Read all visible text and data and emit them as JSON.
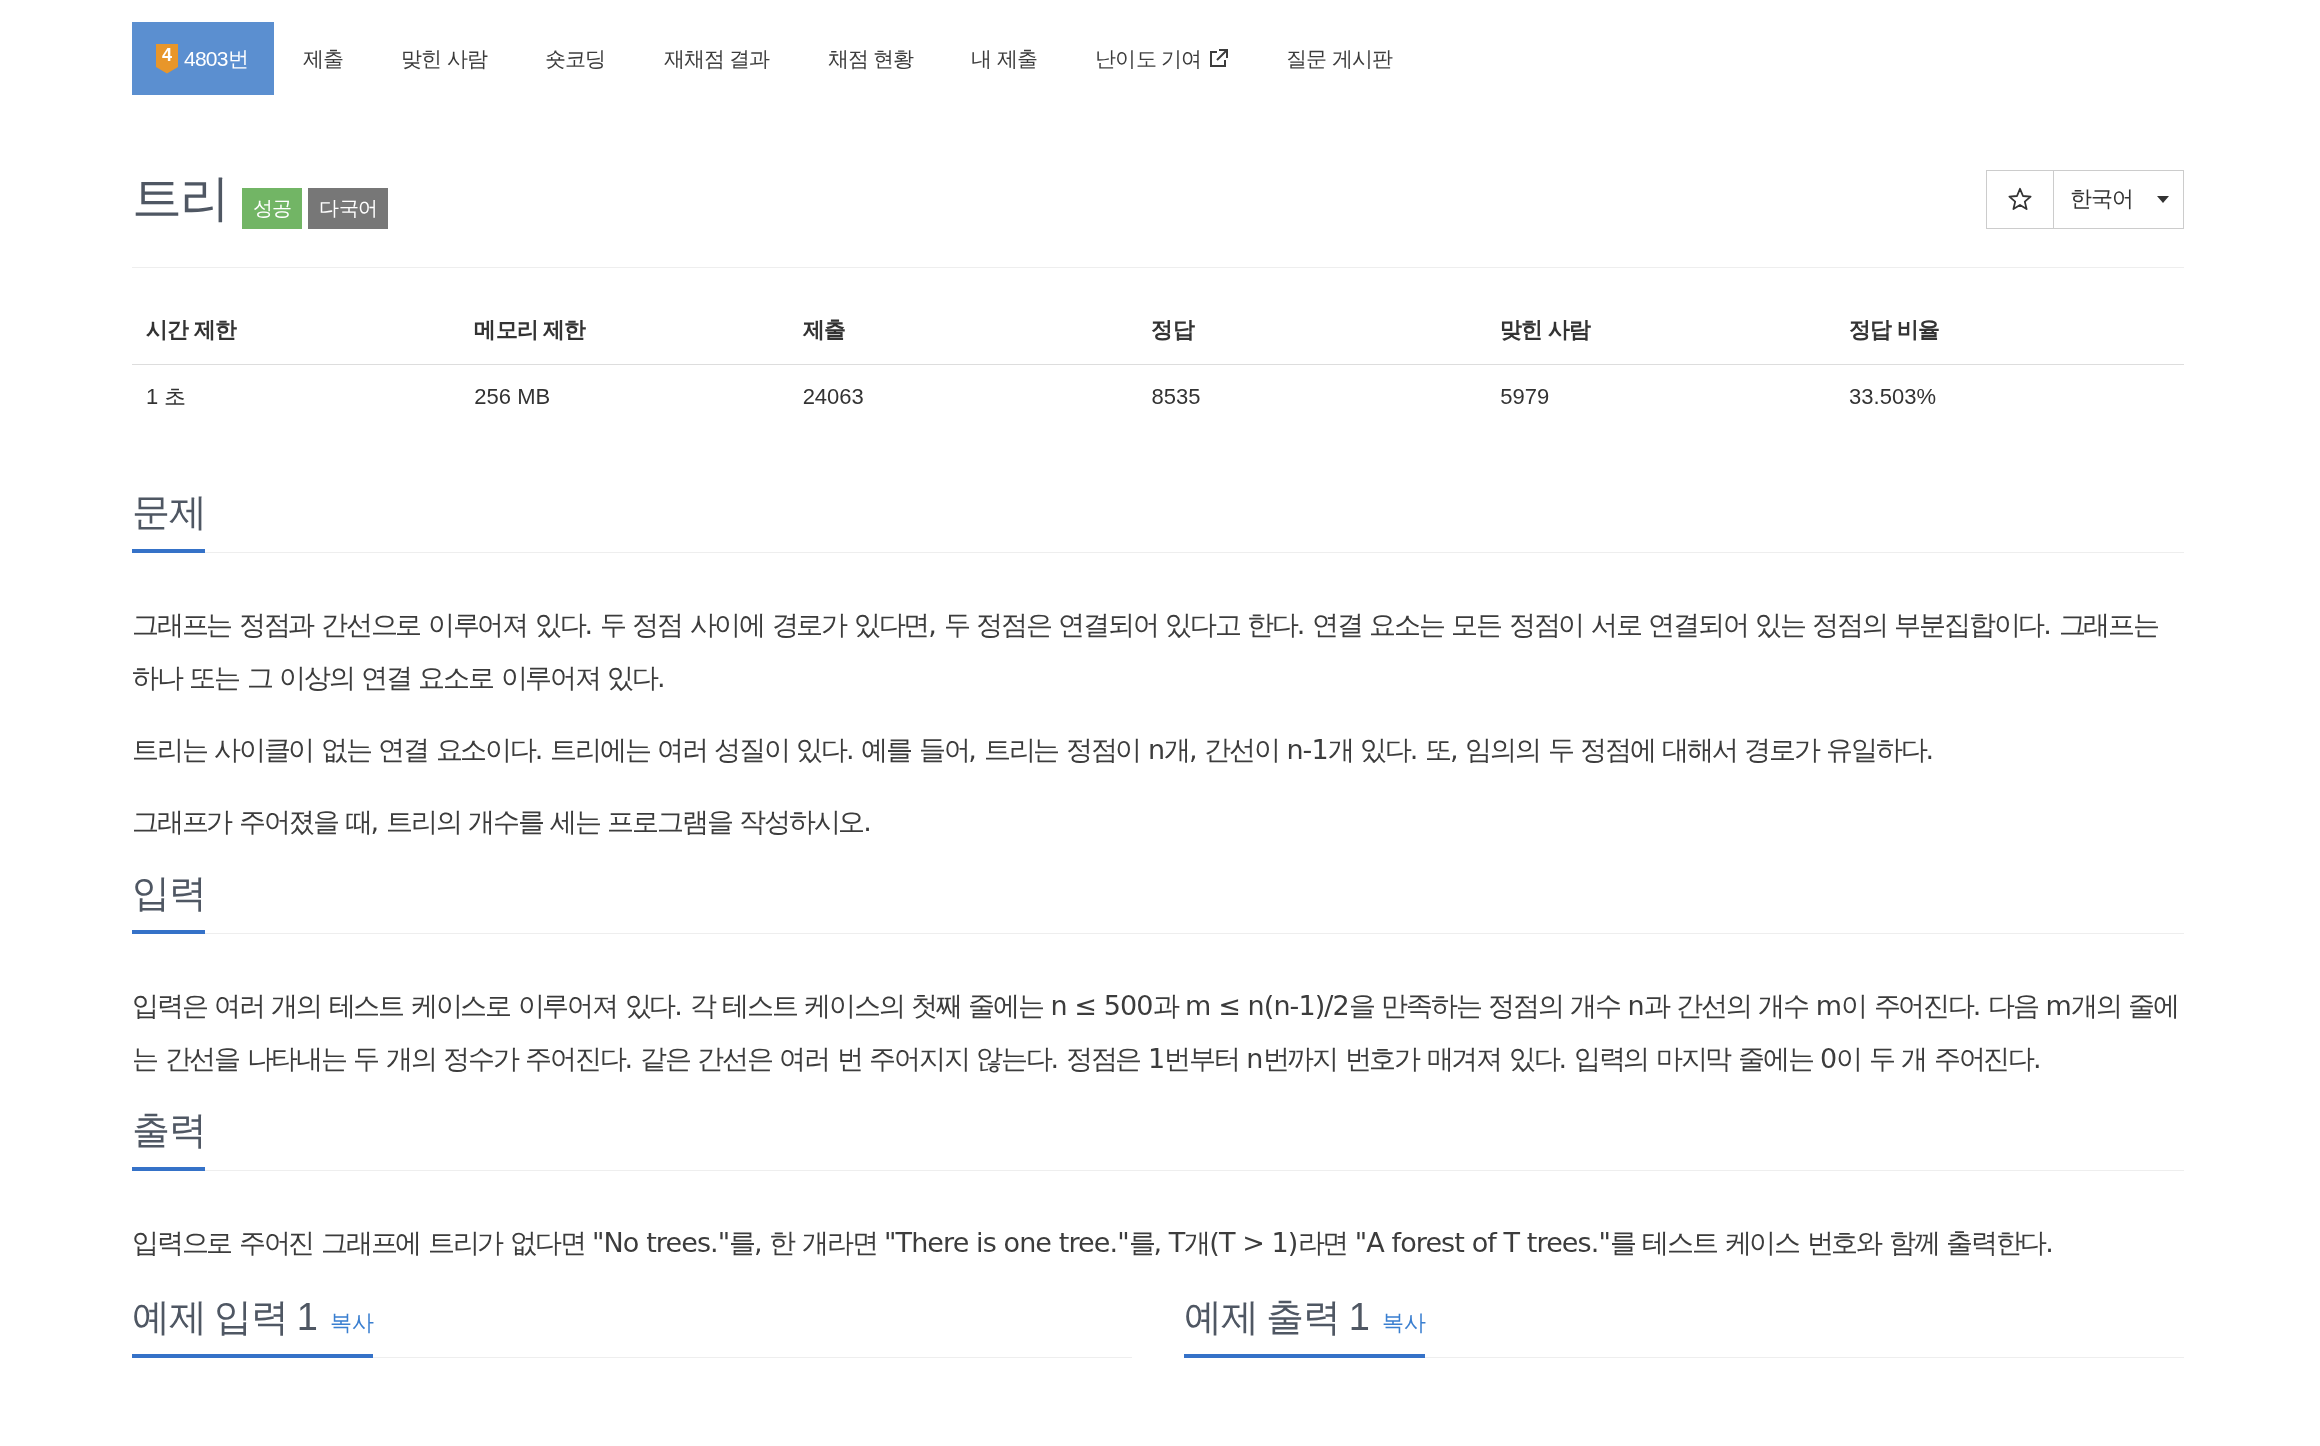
{
  "tabs": [
    {
      "label": "4803번",
      "tier": "4",
      "selected": true,
      "external": false
    },
    {
      "label": "제출",
      "selected": false,
      "external": false
    },
    {
      "label": "맞힌 사람",
      "selected": false,
      "external": false
    },
    {
      "label": "숏코딩",
      "selected": false,
      "external": false
    },
    {
      "label": "재채점 결과",
      "selected": false,
      "external": false
    },
    {
      "label": "채점 현황",
      "selected": false,
      "external": false
    },
    {
      "label": "내 제출",
      "selected": false,
      "external": false
    },
    {
      "label": "난이도 기여",
      "selected": false,
      "external": true
    },
    {
      "label": "질문 게시판",
      "selected": false,
      "external": false
    }
  ],
  "problem": {
    "title": "트리",
    "badges": [
      {
        "label": "성공",
        "kind": "success"
      },
      {
        "label": "다국어",
        "kind": "multilingual"
      }
    ],
    "favorite": false,
    "language": "한국어"
  },
  "info_table": {
    "columns": [
      "시간 제한",
      "메모리 제한",
      "제출",
      "정답",
      "맞힌 사람",
      "정답 비율"
    ],
    "rows": [
      [
        "1 초",
        "256 MB",
        "24063",
        "8535",
        "5979",
        "33.503%"
      ]
    ]
  },
  "sections": [
    {
      "heading": "문제",
      "paragraphs": [
        "그래프는 정점과 간선으로 이루어져 있다. 두 정점 사이에 경로가 있다면, 두 정점은 연결되어 있다고 한다. 연결 요소는 모든 정점이 서로 연결되어 있는 정점의 부분집합이다. 그래프는 하나 또는 그 이상의 연결 요소로 이루어져 있다.",
        "트리는 사이클이 없는 연결 요소이다. 트리에는 여러 성질이 있다. 예를 들어, 트리는 정점이 n개, 간선이 n-1개 있다. 또, 임의의 두 정점에 대해서 경로가 유일하다.",
        "그래프가 주어졌을 때, 트리의 개수를 세는 프로그램을 작성하시오."
      ]
    },
    {
      "heading": "입력",
      "paragraphs": [
        "입력은 여러 개의 테스트 케이스로 이루어져 있다. 각 테스트 케이스의 첫째 줄에는 n ≤ 500과 m ≤ n(n-1)/2을 만족하는 정점의 개수 n과 간선의 개수 m이 주어진다. 다음 m개의 줄에는 간선을 나타내는 두 개의 정수가 주어진다. 같은 간선은 여러 번 주어지지 않는다. 정점은 1번부터 n번까지 번호가 매겨져 있다. 입력의 마지막 줄에는 0이 두 개 주어진다."
      ]
    },
    {
      "heading": "출력",
      "paragraphs": [
        "입력으로 주어진 그래프에 트리가 없다면 \"No trees.\"를, 한 개라면 \"There is one tree.\"를, T개(T > 1)라면 \"A forest of T trees.\"를 테스트 케이스 번호와 함께 출력한다."
      ]
    }
  ],
  "examples": [
    {
      "heading": "예제 입력 1",
      "copy": "복사"
    },
    {
      "heading": "예제 출력 1",
      "copy": "복사"
    }
  ]
}
